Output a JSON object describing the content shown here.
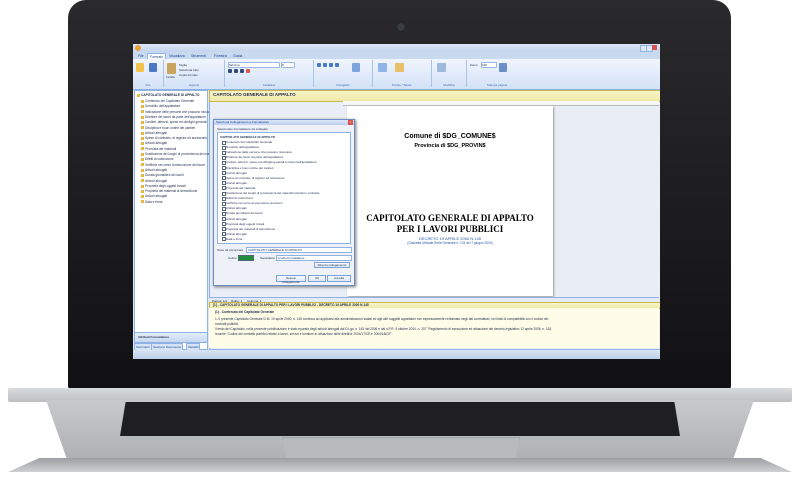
{
  "app": {
    "tabs": [
      "File",
      "Formato",
      "Visualizza",
      "Strumenti",
      "Finestra",
      "Guida"
    ],
    "ribbon": {
      "paste_label": "Incolla",
      "cut_label": "Taglia",
      "copy_label": "Copia",
      "select_all_label": "Seleziona tutto",
      "copy_format_label": "Copia formato",
      "font_name": "Tahoma",
      "font_size": "8",
      "zoom_label": "Zoom",
      "zoom_value": "100",
      "group_labels": [
        "File",
        "Appunti",
        "Carattere",
        "Paragrafo",
        "Parole / Tavolo",
        "Modifica",
        "Stampa pagina"
      ]
    },
    "left_panel": {
      "root_item": "CAPITOLATO GENERALE DI APPALTO",
      "items": [
        "Contenuto del Capitolato Generale",
        "Domicilio dell'appaltatore",
        "Indicazione delle persone che possono riscuotere",
        "Direttore dei lavori da parte dell'appaltatore",
        "Cantieri, attrezzi, spese ed obblighi generali",
        "Disciplina e buon ordine dei cantieri",
        "Articoli abrogati",
        "Spese di contratto, di registro ed accessorie",
        "Articoli abrogati",
        "Provvista dei materiali",
        "Sostituzione dei luoghi di provenienza dei materiali",
        "Difetti di costruzione",
        "Verifiche nel corso di esecuzione dei lavori",
        "Articoli abrogati",
        "Durata giornaliera dei lavori",
        "Articoli abrogati",
        "Proprietà degli oggetti trovati",
        "Proprietà dei materiali di demolizione",
        "Articoli abrogati",
        "Data e firma"
      ],
      "bottom_title": "Attributi Formattatore",
      "tabs": [
        "Sommario",
        "Gestione Documento",
        "Variabili"
      ]
    },
    "document": {
      "header_title": "CAPITOLATO GENERALE DI APPALTO",
      "comune_line": "Comune di $DG_COMUNE$",
      "provincia_line": "Provincia di $DG_PROVIN$",
      "main_title_1": "CAPITOLATO GENERALE DI APPALTO",
      "main_title_2": "PER I LAVORI PUBBLICI",
      "decree_line": "DECRETO 19 APRILE 2000 N.145",
      "gazette_line": "(Gazzetta Ufficiale Serie Generale n. 131 del 7 giugno 2000)",
      "pagebar_items": [
        "Pagina: 1/1",
        "Righe: 1",
        "Colonna: 1"
      ]
    },
    "dialog": {
      "title": "Seleziona Collegamento a Formattatore",
      "subtitle": "Selezionare Formattatore da collegare",
      "root": "CAPITOLATO GENERALE DI APPALTO",
      "items": [
        "Contenuto del Capitolato Generale",
        "Domicilio dell'appaltatore",
        "Indicazione delle persone che possono riscuotere",
        "Direttore dei lavori da parte dell'appaltatore",
        "Cantieri, attrezzi, spese ed obblighi generali a carico dell'appaltatore",
        "Disciplina e buon ordine dei cantieri",
        "Articoli abrogati",
        "Spese di contratto, di registro ed accessorie",
        "Articoli abrogati",
        "Provvista dei materiali",
        "Sostituzione dei luoghi di provenienza dei materiali previsti in contratto",
        "Difetti di costruzione",
        "Verifiche nel corso di esecuzione dei lavori",
        "Articoli abrogati",
        "Durata giornaliera dei lavori",
        "Articoli abrogati",
        "Proprietà degli oggetti trovati",
        "Proprietà dei materiali di demolizione",
        "Articoli abrogati",
        "Data e firma"
      ],
      "path_label": "Testo da riscontrare",
      "path_value": "CAPITOLATO GENERALE DI APPALTO",
      "color_label": "Colore",
      "separator_label": "Separatore",
      "separator_value": "Livello Formattatore",
      "reset_button": "Ricerca collegamento",
      "buttons": [
        "Nessun collegamento",
        "OK",
        "Annulla"
      ],
      "color_value": "#1f8f3a"
    },
    "editor": {
      "info_title": "[1] - CAPITOLATO GENERALE DI APPALTO PER I LAVORI PUBBLICI - DECRETO 19 APRILE 2000 N.145",
      "lines": [
        "(1) - Contenuto del Capitolato Generale",
        "1. Il presente Capitolato Generale D.M. 19 aprile 2000, n. 145 continua ad applicarsi alle amministrazioni statali ed agli altri soggetti appaltatori ove espressamente richiamato negli atti contrattuali, nei limiti di compatibilità con il codice dei",
        "contratti pubblici.",
        "Il testo del Capitolato, nella presente pubblicazione è stato epurato degli articoli abrogati dal D.Lgs. n. 163 del 2006 e dal d.P.R. 5 ottobre 2010, n. 207 \"Regolamento di esecuzione ed attuazione del decreto legislativo 12 aprile 2006, n. 163,",
        "recante \"Codice dei contratti pubblici relativi a lavori, servizi e forniture in attuazione delle direttive 2004/17/CE e 2004/18/CE\"."
      ]
    },
    "colors": {
      "ribbon_blue": "#c9d9f0",
      "header_yellow": "#efe9a8",
      "link_blue": "#15428b"
    }
  }
}
